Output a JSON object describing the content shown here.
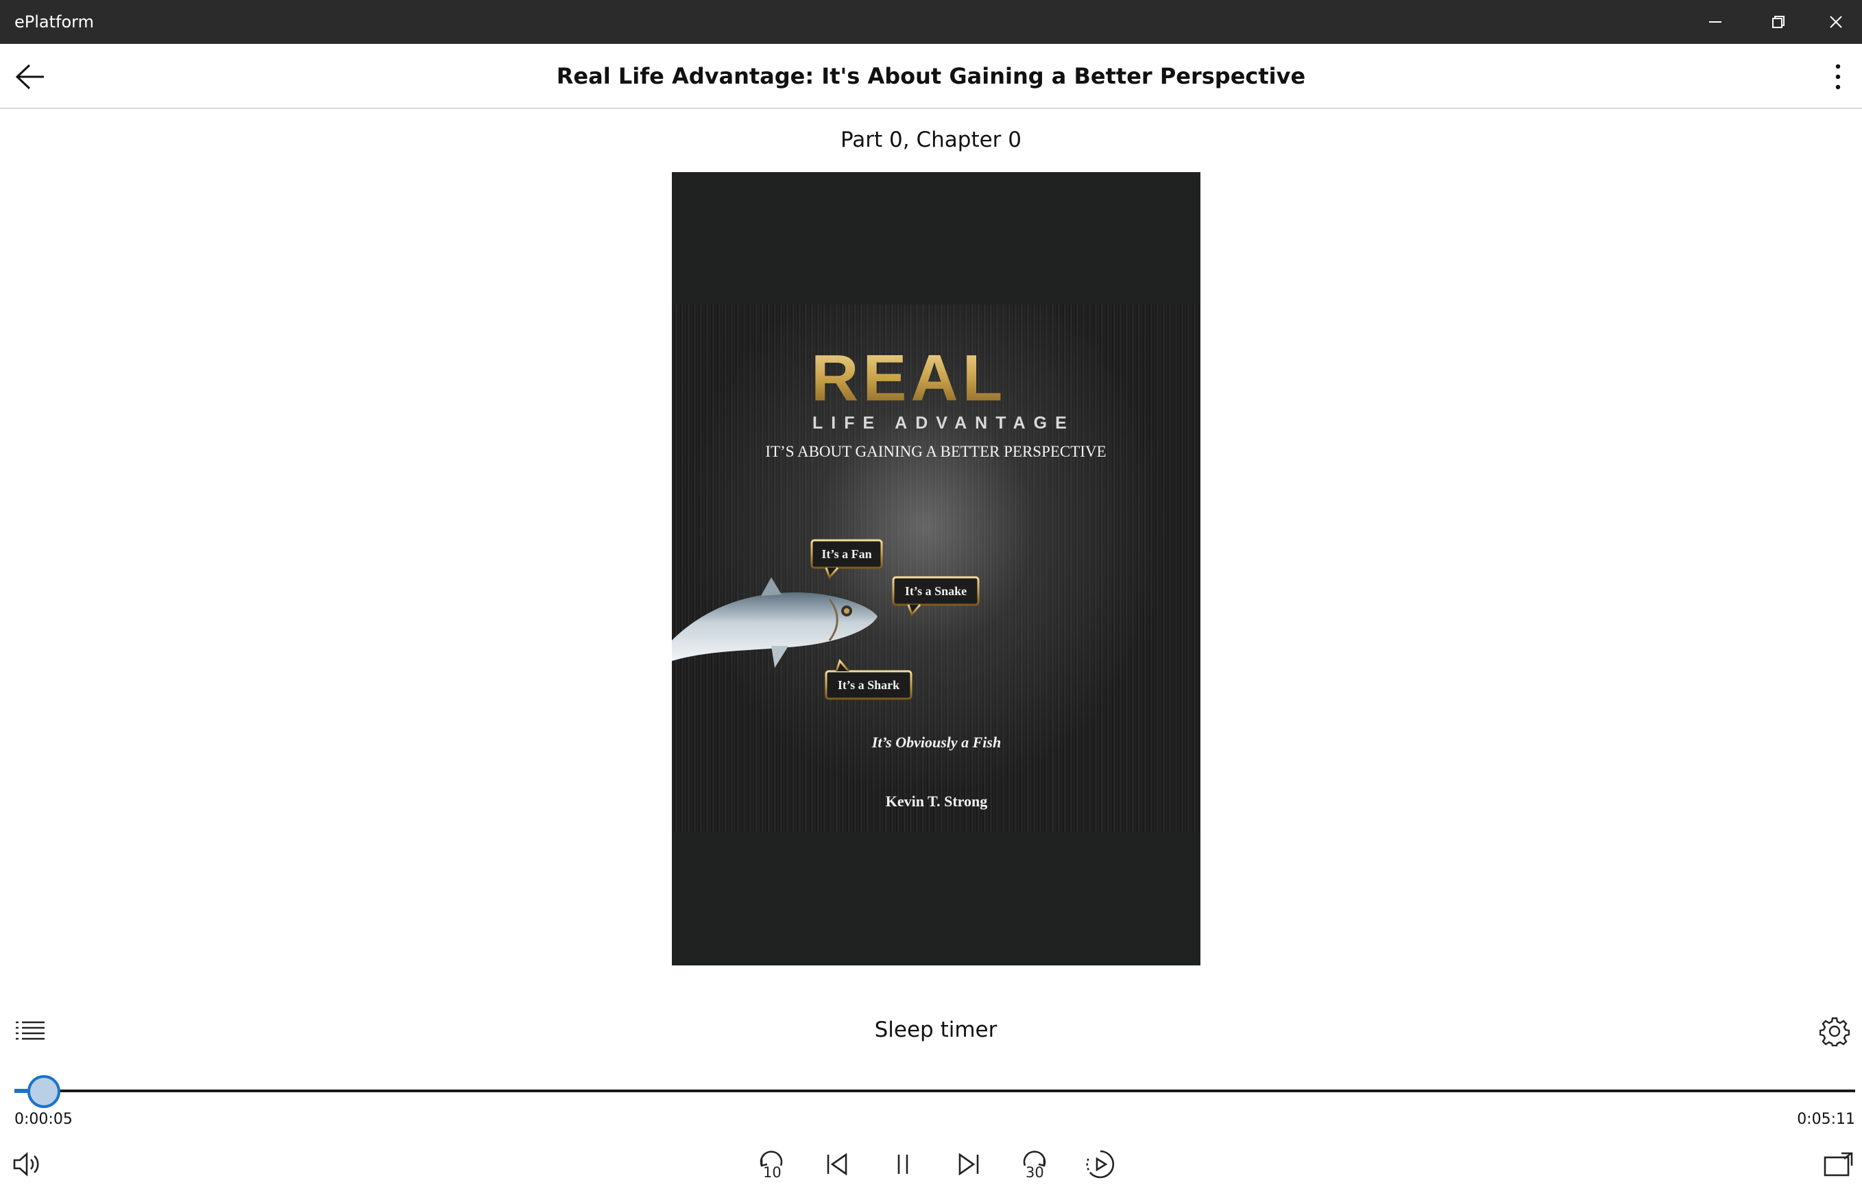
{
  "window": {
    "app_name": "ePlatform"
  },
  "header": {
    "title": "Real Life Advantage: It's About Gaining a Better Perspective"
  },
  "chapter_label": "Part 0, Chapter 0",
  "cover": {
    "logo_word": "REAL",
    "logo_sub": "LIFE ADVANTAGE",
    "subtitle": "IT’S ABOUT GAINING A BETTER PERSPECTIVE",
    "bubble_fan": "It’s a Fan",
    "bubble_snake": "It’s a Snake",
    "bubble_shark": "It’s a Shark",
    "tagline": "It’s Obviously a Fish",
    "author": "Kevin T. Strong"
  },
  "controls": {
    "sleep_timer_label": "Sleep timer",
    "elapsed": "0:00:05",
    "total": "0:05:11",
    "progress": 0.016,
    "rewind_seconds": "10",
    "forward_seconds": "30"
  },
  "colors": {
    "accent": "#1a73c9",
    "titlebar": "#2b2b2b",
    "gold": "#c9a24a"
  }
}
